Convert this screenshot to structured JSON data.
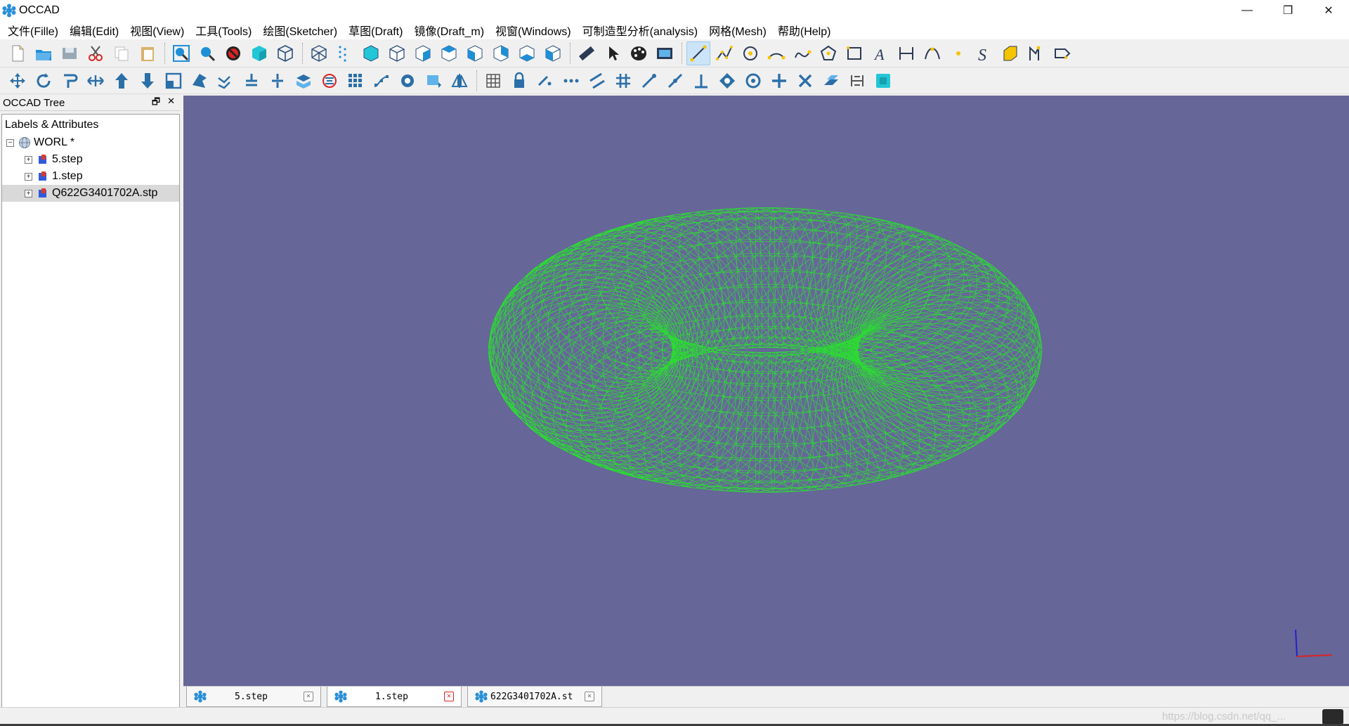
{
  "window": {
    "title": "OCCAD",
    "minimize": "—",
    "maximize": "❐",
    "close": "✕"
  },
  "menu": [
    "文件(Fille)",
    "编辑(Edit)",
    "视图(View)",
    "工具(Tools)",
    "绘图(Sketcher)",
    "草图(Draft)",
    "镜像(Draft_m)",
    "视窗(Windows)",
    "可制造型分析(analysis)",
    "网格(Mesh)",
    "帮助(Help)"
  ],
  "toolbar1": [
    "new-file",
    "open-folder",
    "save",
    "cut",
    "copy",
    "paste",
    "sep",
    "zoom-fit",
    "zoom",
    "no-draw",
    "shaded-cube",
    "wire-cube",
    "sep",
    "iso-cube",
    "points",
    "cube-solid",
    "view-front",
    "view-top",
    "view-right",
    "view-left",
    "view-rear",
    "view-bottom",
    "view-axo",
    "sep",
    "measure",
    "pointer",
    "palette",
    "image",
    "sep",
    "line",
    "polyline",
    "circle",
    "arc",
    "bspline",
    "polygon",
    "rectangle",
    "text",
    "dimension",
    "bezier",
    "point",
    "s-curve",
    "extrude",
    "shape-builder",
    "label"
  ],
  "toolbar2": [
    "move",
    "rotate",
    "offset",
    "stretch",
    "up",
    "down",
    "scale",
    "upgrade",
    "trimex",
    "join",
    "split",
    "shape2d",
    "clone",
    "array",
    "path-array",
    "wire-to-bspline",
    "mirror-edit",
    "draft-to-sketch",
    "sep",
    "grid",
    "lock",
    "snap-near",
    "snap-dots",
    "snap-parallel",
    "snap-grid",
    "snap-endpoint",
    "snap-midpoint",
    "snap-perpendicular",
    "snap-special",
    "snap-center",
    "snap-ortho",
    "snap-intersection",
    "snap-working-plane",
    "snap-dimensions",
    "snap-toggle"
  ],
  "toolbar1_active": "line",
  "tree": {
    "title": "OCCAD Tree",
    "float_btn": "🗗",
    "close_btn": "✕",
    "column_header": "Labels & Attributes",
    "root": {
      "label": "WORL *",
      "expander": "−"
    },
    "children": [
      {
        "label": "5.step",
        "expander": "+"
      },
      {
        "label": "1.step",
        "expander": "+"
      },
      {
        "label": "Q622G3401702A.stp",
        "expander": "+",
        "selected": true
      }
    ]
  },
  "viewport": {
    "background": "#666699",
    "mesh_color": "#22ee22",
    "shape": "torus",
    "display_mode": "wireframe",
    "axis_colors": {
      "x": "#dd2222",
      "y": "#2222cc"
    }
  },
  "tabs": [
    {
      "label": "5.step",
      "active": false,
      "close": "✕"
    },
    {
      "label": "1.step",
      "active": true,
      "close": "✕"
    },
    {
      "label": "622G3401702A.st",
      "active": false,
      "close": "✕"
    }
  ],
  "status": {
    "watermark": "https://blog.csdn.net/qq_..."
  }
}
